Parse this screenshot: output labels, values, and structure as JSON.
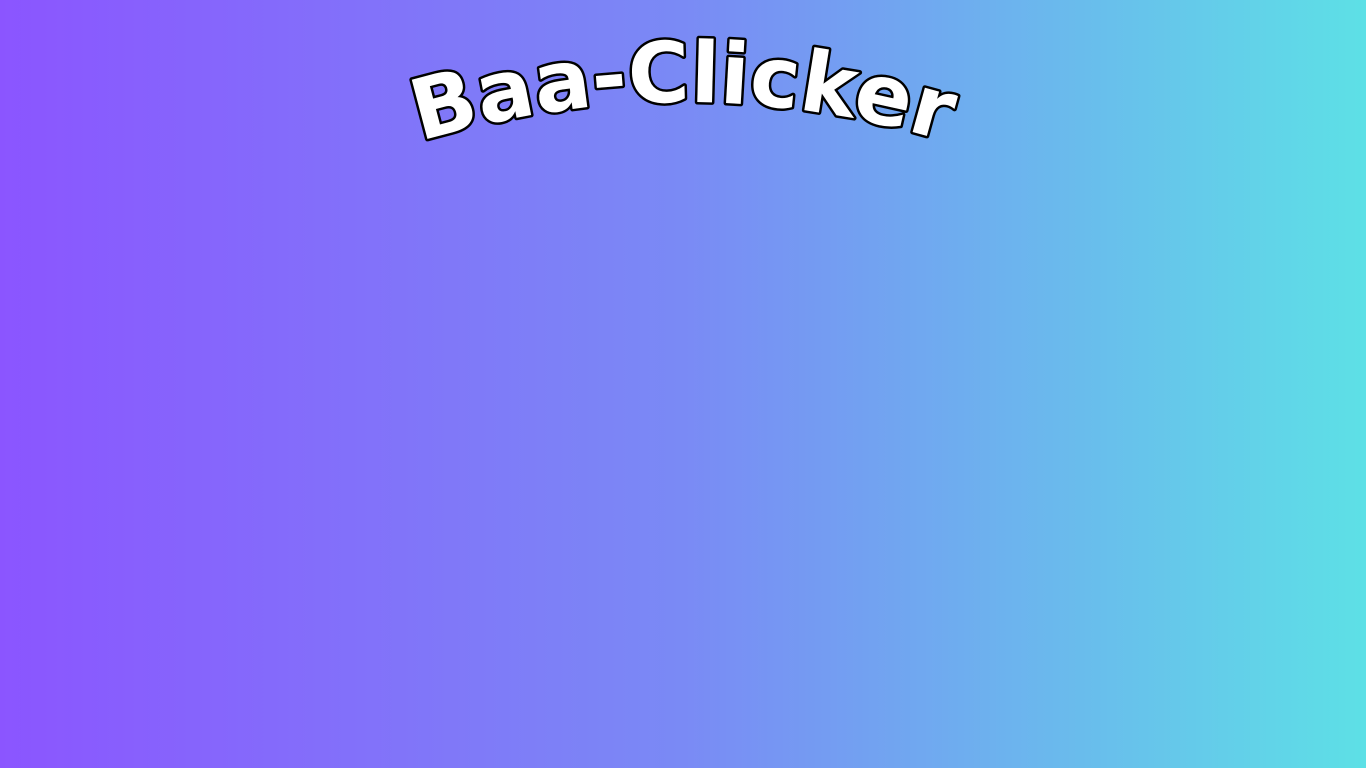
{
  "game": {
    "title": "Baa-Clicker"
  },
  "colors": {
    "background_left": "#8b55ff",
    "background_mid": "#7a8af5",
    "background_right": "#5de0e6",
    "title_fill": "#ffffff",
    "title_outline": "#000000"
  }
}
